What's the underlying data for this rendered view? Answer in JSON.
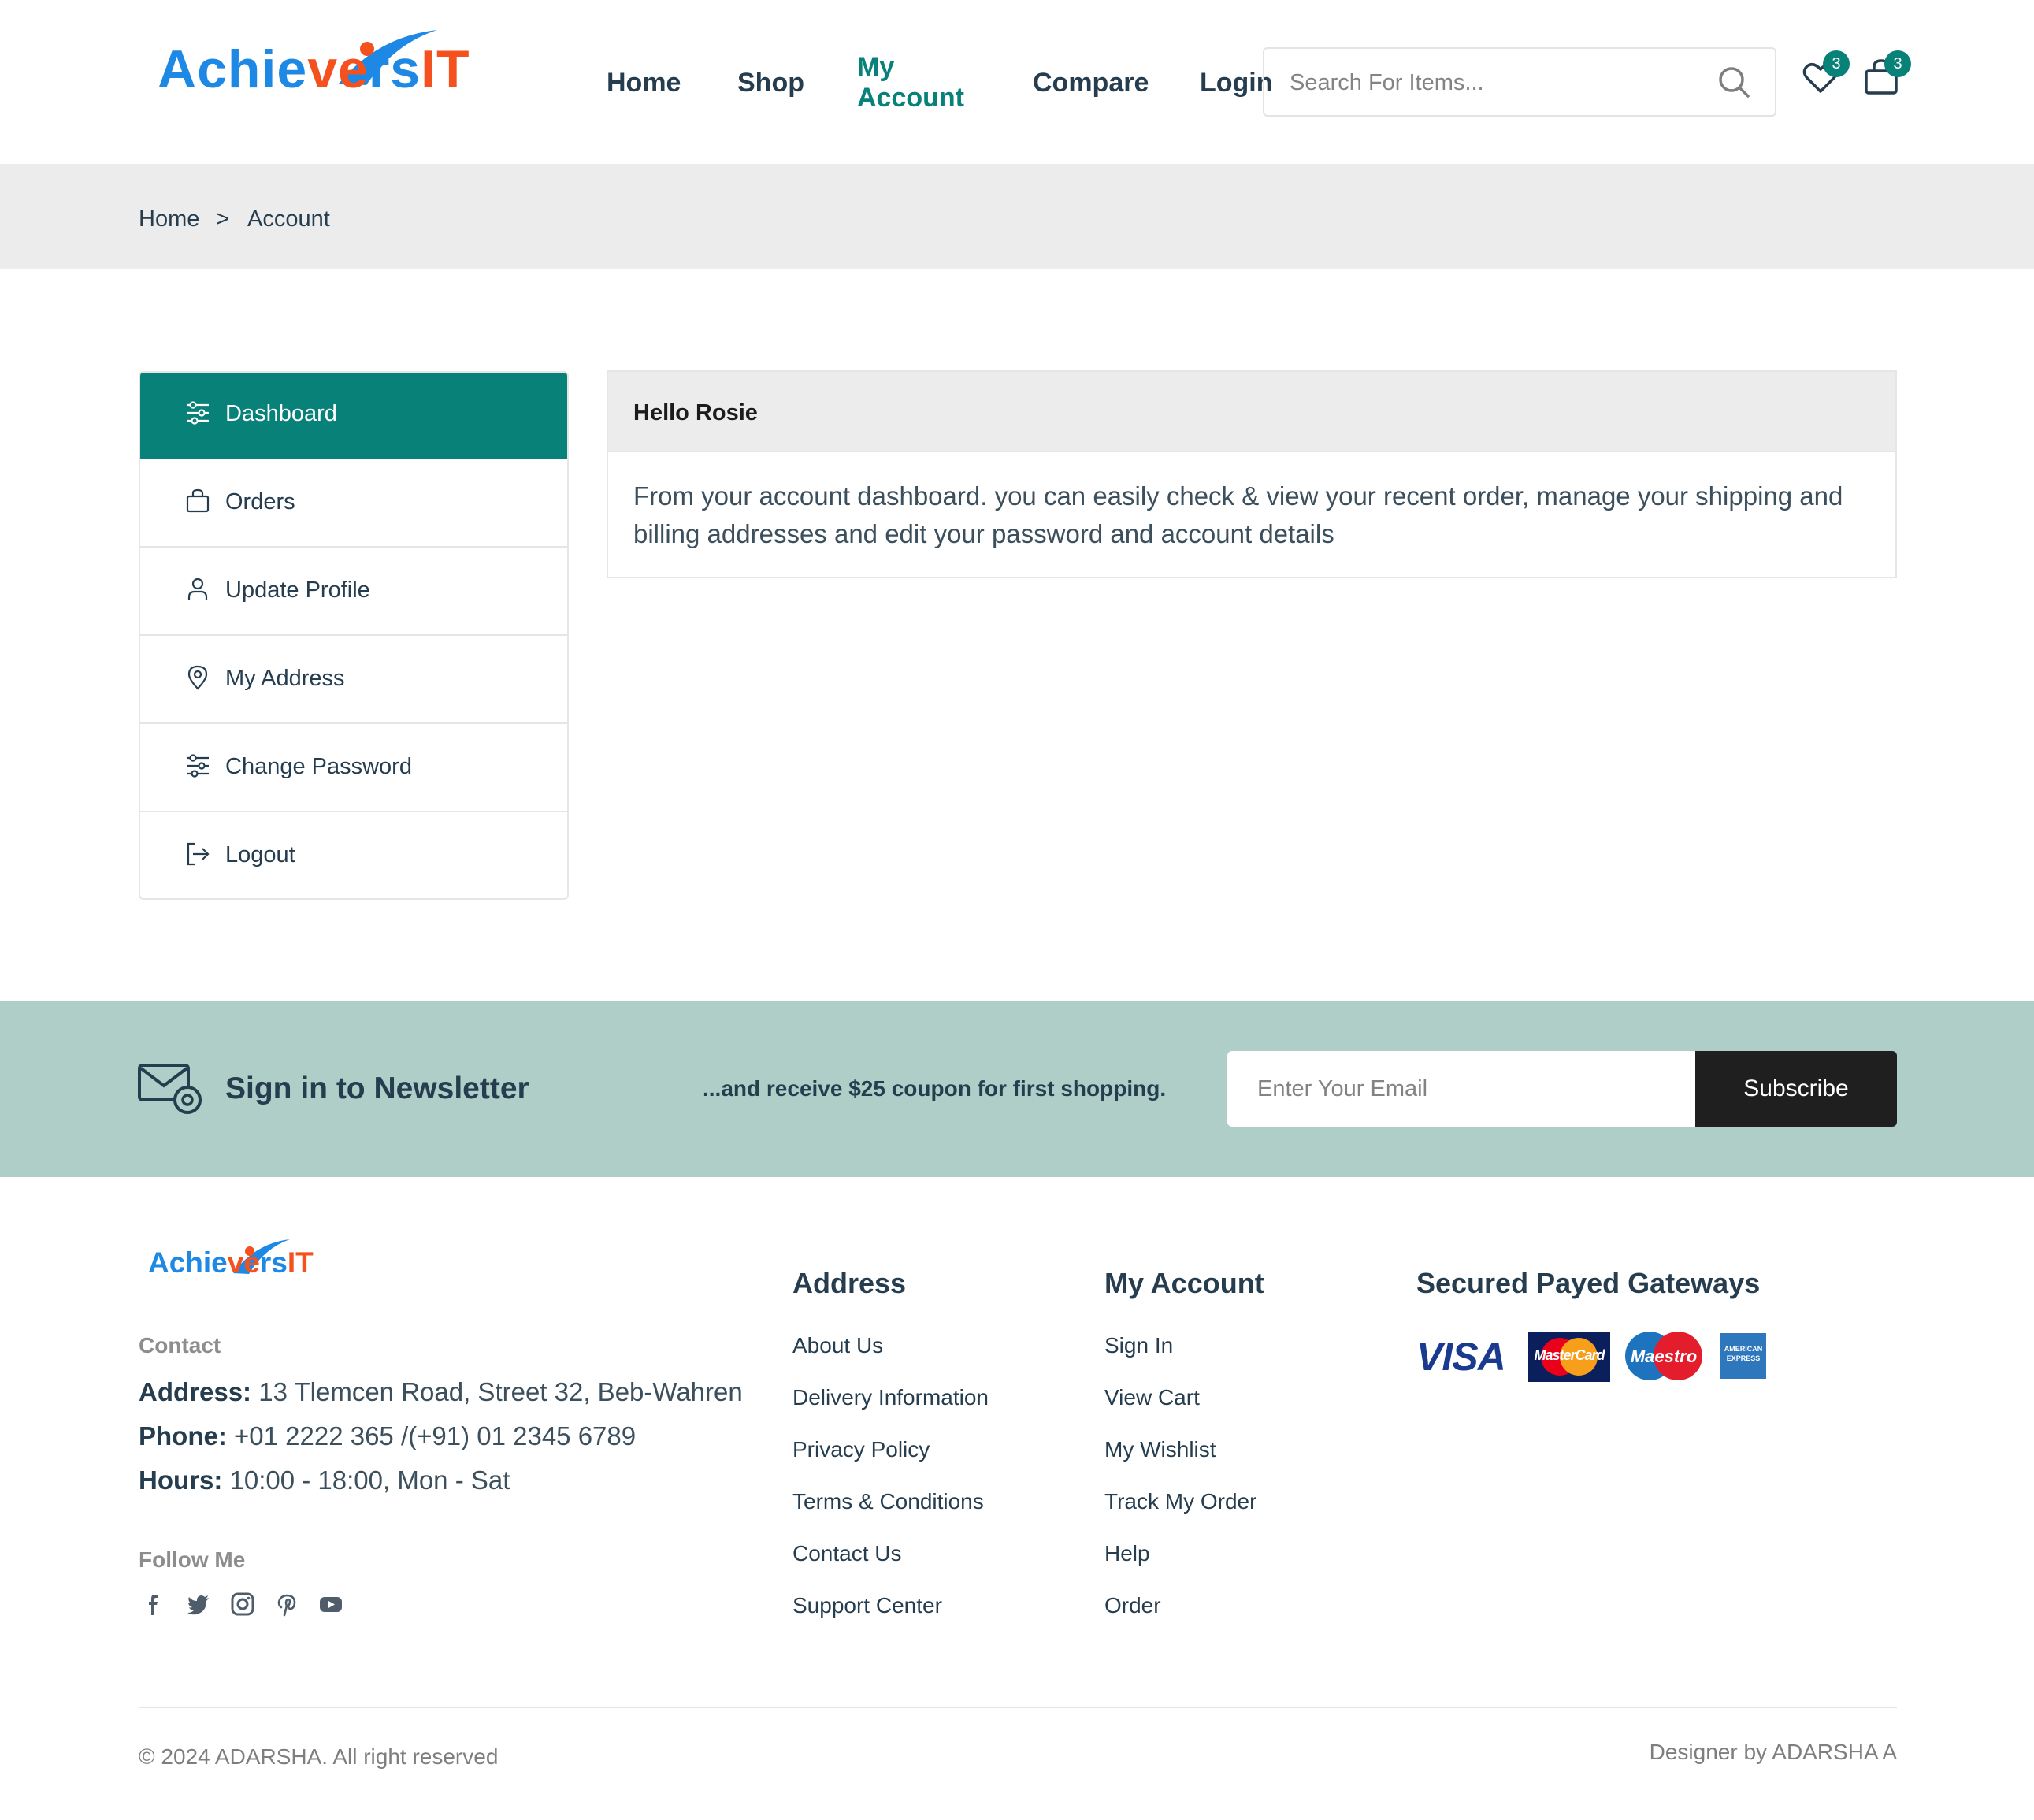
{
  "header": {
    "logo": {
      "part1": "Achie",
      "part2": "ve",
      "part3": "rs",
      "part4": "IT"
    },
    "nav": [
      {
        "label": "Home"
      },
      {
        "label": "Shop"
      },
      {
        "label": "My Account",
        "line1": "My",
        "line2": "Account"
      },
      {
        "label": "Compare"
      },
      {
        "label": "Login"
      }
    ],
    "search_placeholder": "Search For Items...",
    "wishlist_count": "3",
    "cart_count": "3"
  },
  "breadcrumb": {
    "home": "Home",
    "separator": ">",
    "current": "Account"
  },
  "sidebar": {
    "items": [
      {
        "label": "Dashboard",
        "icon": "sliders-icon"
      },
      {
        "label": "Orders",
        "icon": "bag-icon"
      },
      {
        "label": "Update Profile",
        "icon": "user-icon"
      },
      {
        "label": "My Address",
        "icon": "location-pin-icon"
      },
      {
        "label": "Change Password",
        "icon": "sliders-icon"
      },
      {
        "label": "Logout",
        "icon": "logout-icon"
      }
    ]
  },
  "dashboard": {
    "greeting": "Hello Rosie",
    "body": "From your account dashboard. you can easily check & view your recent order, manage your shipping and billing addresses and edit your password and account details"
  },
  "newsletter": {
    "title": "Sign in to Newsletter",
    "subtitle": "...and receive $25 coupon for first shopping.",
    "email_placeholder": "Enter Your Email",
    "button": "Subscribe"
  },
  "footer": {
    "contact_label": "Contact",
    "address_label": "Address:",
    "address": "13 Tlemcen Road, Street 32, Beb-Wahren",
    "phone_label": "Phone:",
    "phone": "+01 2222 365 /(+91) 01 2345 6789",
    "hours_label": "Hours:",
    "hours": "10:00 - 18:00, Mon - Sat",
    "follow_label": "Follow Me",
    "social": [
      "facebook-icon",
      "twitter-icon",
      "instagram-icon",
      "pinterest-icon",
      "youtube-icon"
    ],
    "col1": {
      "title": "Address",
      "links": [
        "About Us",
        "Delivery Information",
        "Privacy Policy",
        "Terms & Conditions",
        "Contact Us",
        "Support Center"
      ]
    },
    "col2": {
      "title": "My Account",
      "links": [
        "Sign In",
        "View Cart",
        "My Wishlist",
        "Track My Order",
        "Help",
        "Order"
      ]
    },
    "col3": {
      "title": "Secured Payed Gateways",
      "visa": "VISA",
      "mastercard": "MasterCard",
      "maestro": "Maestro",
      "amex": "AMERICAN EXPRESS"
    },
    "copyright": "© 2024 ADARSHA. All right reserved",
    "designer": "Designer by ADARSHA A"
  },
  "colors": {
    "accent": "#088178",
    "newsletter_bg": "#afcec7",
    "breadcrumb_bg": "#ececec",
    "logo_blue": "#1e88e5",
    "logo_orange": "#f4511e"
  }
}
